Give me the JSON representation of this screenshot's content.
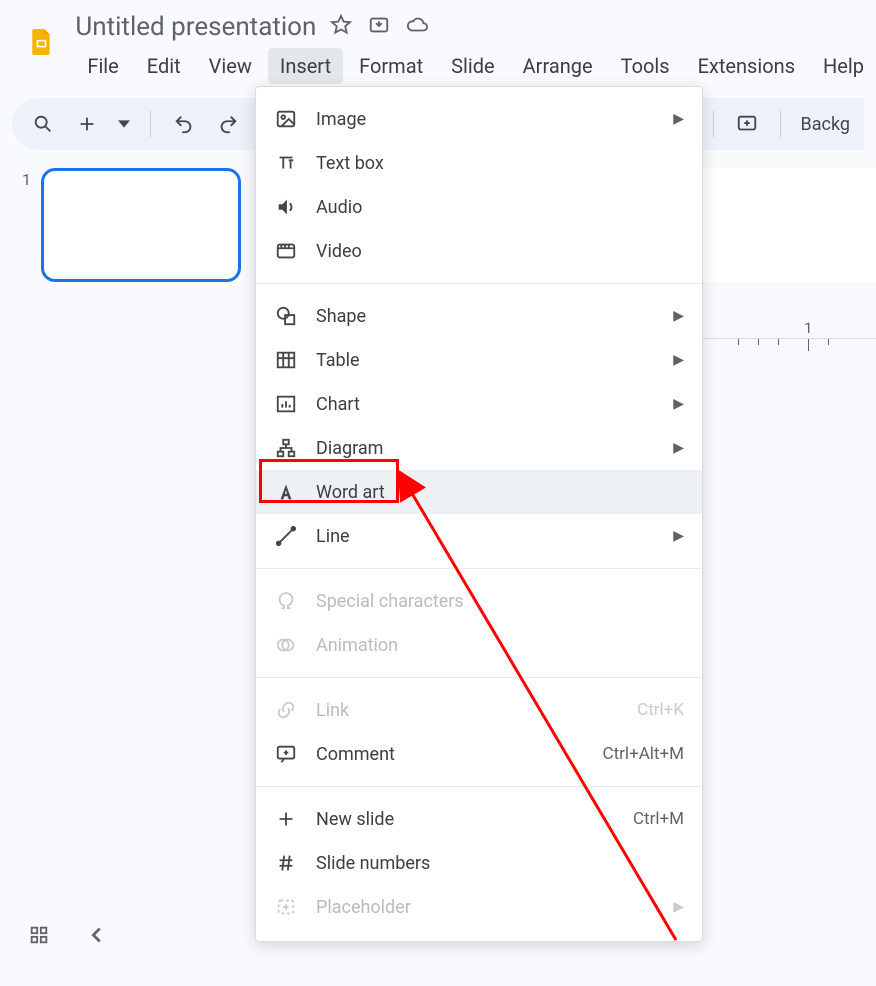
{
  "doc": {
    "title": "Untitled presentation"
  },
  "menus": {
    "file": "File",
    "edit": "Edit",
    "view": "View",
    "insert": "Insert",
    "format": "Format",
    "slide": "Slide",
    "arrange": "Arrange",
    "tools": "Tools",
    "extensions": "Extensions",
    "help": "Help",
    "active": "insert"
  },
  "toolbar": {
    "background_label": "Backg"
  },
  "slidepanel": {
    "slide_number": "1"
  },
  "ruler": {
    "mark_label": "1"
  },
  "insert_menu": {
    "items": [
      {
        "id": "image",
        "label": "Image",
        "submenu": true
      },
      {
        "id": "textbox",
        "label": "Text box"
      },
      {
        "id": "audio",
        "label": "Audio"
      },
      {
        "id": "video",
        "label": "Video"
      },
      {
        "sep": true
      },
      {
        "id": "shape",
        "label": "Shape",
        "submenu": true
      },
      {
        "id": "table",
        "label": "Table",
        "submenu": true
      },
      {
        "id": "chart",
        "label": "Chart",
        "submenu": true
      },
      {
        "id": "diagram",
        "label": "Diagram",
        "submenu": true
      },
      {
        "id": "wordart",
        "label": "Word art",
        "highlight": true
      },
      {
        "id": "line",
        "label": "Line",
        "submenu": true
      },
      {
        "sep": true
      },
      {
        "id": "specialchars",
        "label": "Special characters",
        "disabled": true
      },
      {
        "id": "animation",
        "label": "Animation",
        "disabled": true
      },
      {
        "sep": true
      },
      {
        "id": "link",
        "label": "Link",
        "shortcut": "Ctrl+K",
        "disabled": true
      },
      {
        "id": "comment",
        "label": "Comment",
        "shortcut": "Ctrl+Alt+M"
      },
      {
        "sep": true
      },
      {
        "id": "newslide",
        "label": "New slide",
        "shortcut": "Ctrl+M"
      },
      {
        "id": "slidenumbers",
        "label": "Slide numbers"
      },
      {
        "id": "placeholder",
        "label": "Placeholder",
        "submenu": true,
        "disabled": true
      }
    ]
  },
  "annotation": {
    "target": "wordart"
  }
}
